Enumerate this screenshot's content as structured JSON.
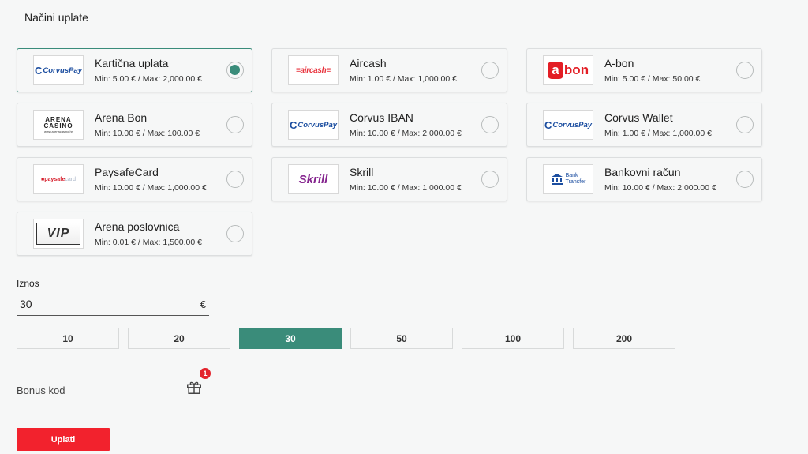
{
  "page": {
    "title": "Načini uplate"
  },
  "methods": [
    {
      "name": "Kartična uplata",
      "limits": "Min: 5.00 € / Max: 2,000.00 €",
      "logo": "corvus-pay-logo",
      "logo_text": "CorvusPay",
      "selected": true
    },
    {
      "name": "Aircash",
      "limits": "Min: 1.00 € / Max: 1,000.00 €",
      "logo": "aircash-logo",
      "logo_text": "aircash"
    },
    {
      "name": "A-bon",
      "limits": "Min: 5.00 € / Max: 50.00 €",
      "logo": "abon-logo",
      "logo_text_a": "a",
      "logo_text_b": "bon"
    },
    {
      "name": "Arena Bon",
      "limits": "Min: 10.00 € / Max: 100.00 €",
      "logo": "arena-casino-logo",
      "logo_text_1": "ARENA",
      "logo_text_2": "CASINO",
      "logo_text_3": "www.arenacasino.hr"
    },
    {
      "name": "Corvus IBAN",
      "limits": "Min: 10.00 € / Max: 2,000.00 €",
      "logo": "corvus-pay-logo",
      "logo_text": "CorvusPay"
    },
    {
      "name": "Corvus Wallet",
      "limits": "Min: 1.00 € / Max: 1,000.00 €",
      "logo": "corvus-pay-logo",
      "logo_text": "CorvusPay"
    },
    {
      "name": "PaysafeCard",
      "limits": "Min: 10.00 € / Max: 1,000.00 €",
      "logo": "paysafecard-logo",
      "logo_text_a": "paysafe",
      "logo_text_b": "card"
    },
    {
      "name": "Skrill",
      "limits": "Min: 10.00 € / Max: 1,000.00 €",
      "logo": "skrill-logo",
      "logo_text": "Skrill"
    },
    {
      "name": "Bankovni račun",
      "limits": "Min: 10.00 € / Max: 2,000.00 €",
      "logo": "bank-transfer-logo",
      "logo_text_a": "Bank",
      "logo_text_b": "Transfer"
    },
    {
      "name": "Arena poslovnica",
      "limits": "Min: 0.01 € / Max: 1,500.00 €",
      "logo": "vip-logo",
      "logo_text": "VIP"
    }
  ],
  "amount": {
    "label": "Iznos",
    "value": "30",
    "currency": "€"
  },
  "presets": [
    "10",
    "20",
    "30",
    "50",
    "100",
    "200"
  ],
  "active_preset": "30",
  "bonus": {
    "placeholder": "Bonus kod",
    "badge_count": "1"
  },
  "submit_label": "Uplati",
  "colors": {
    "accent": "#3a8c7a",
    "danger": "#f2222d"
  }
}
